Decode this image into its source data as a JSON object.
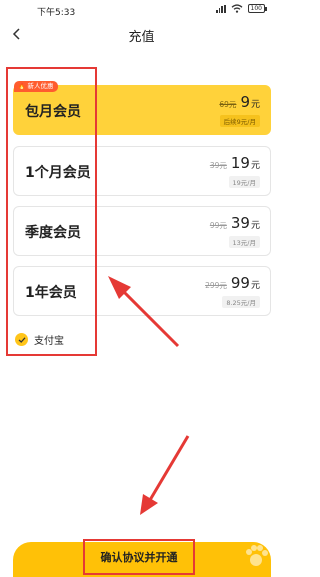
{
  "status_bar": {
    "time": "下午5:33",
    "battery": "100"
  },
  "header": {
    "title": "充值"
  },
  "badge": {
    "label": "新人优惠"
  },
  "plans": [
    {
      "name": "包月会员",
      "original_price": "69元",
      "price": "9",
      "price_unit": "元",
      "per_month": "后续9元/月",
      "selected": true
    },
    {
      "name": "1个月会员",
      "original_price": "39元",
      "price": "19",
      "price_unit": "元",
      "per_month": "19元/月",
      "selected": false
    },
    {
      "name": "季度会员",
      "original_price": "99元",
      "price": "39",
      "price_unit": "元",
      "per_month": "13元/月",
      "selected": false
    },
    {
      "name": "1年会员",
      "original_price": "299元",
      "price": "99",
      "price_unit": "元",
      "per_month": "8.25元/月",
      "selected": false
    }
  ],
  "payment": {
    "method": "支付宝"
  },
  "confirm_button": {
    "label": "确认协议并开通"
  },
  "colors": {
    "accent": "#ffc107",
    "selected_card": "#ffd23a",
    "badge": "#ff5c2e",
    "annotation": "#e53935"
  }
}
